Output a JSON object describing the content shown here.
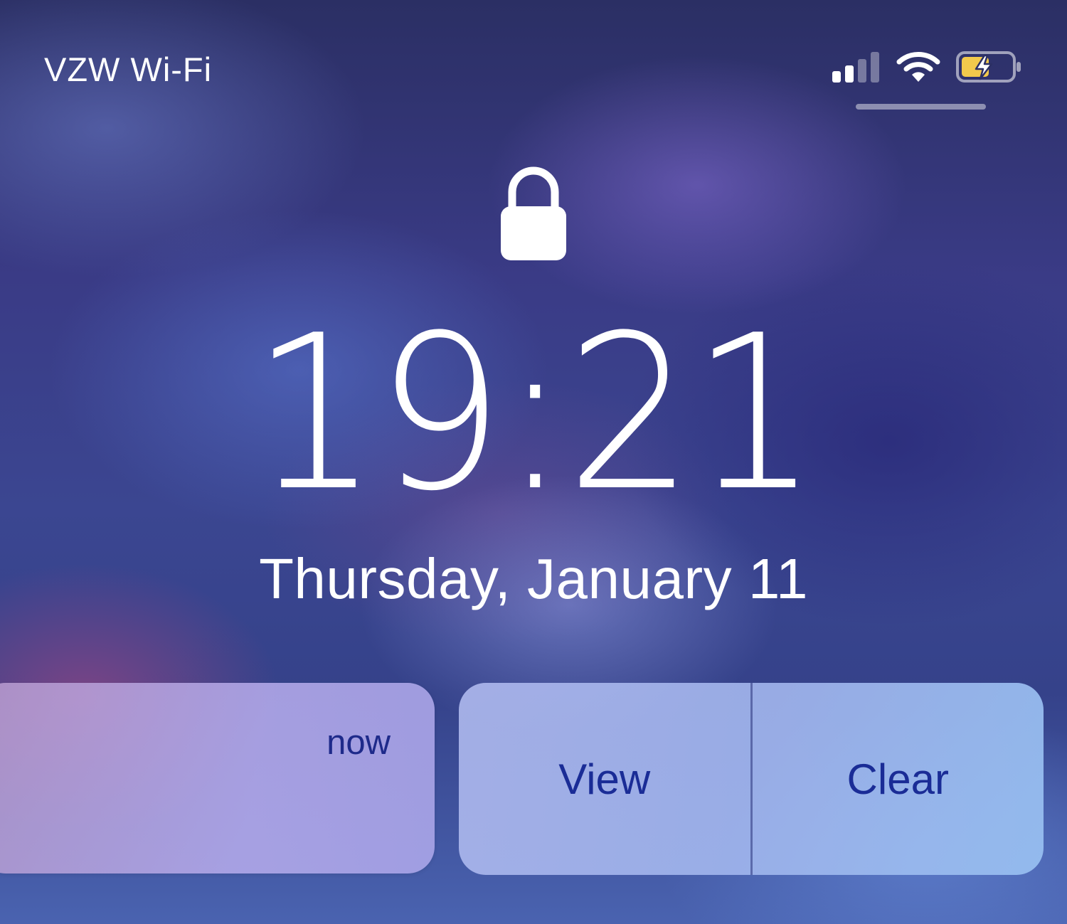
{
  "status_bar": {
    "carrier": "VZW Wi-Fi",
    "signal_bars_filled": 2,
    "signal_bars_total": 4,
    "wifi_icon": "wifi-icon",
    "battery_icon": "battery-charging-icon",
    "battery_color": "#f2c94c"
  },
  "lock_screen": {
    "lock_icon": "lock-icon",
    "time": "19:21",
    "date": "Thursday, January 11"
  },
  "notification": {
    "time": "now",
    "actions": [
      {
        "label": "View"
      },
      {
        "label": "Clear"
      }
    ]
  },
  "colors": {
    "action_text": "#1a2c96"
  }
}
